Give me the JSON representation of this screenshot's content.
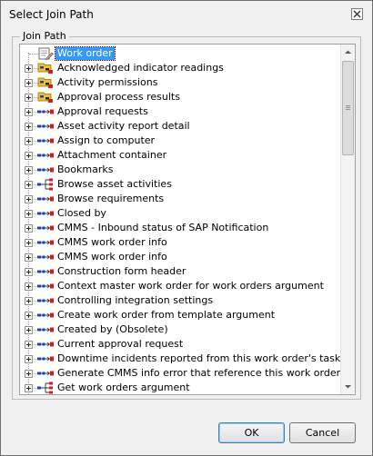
{
  "dialog": {
    "title": "Select Join Path",
    "close_label": "close",
    "group_label": "Join Path",
    "ok_label": "OK",
    "cancel_label": "Cancel"
  },
  "tree": {
    "root": {
      "label": "Work order",
      "icon": "work-order-icon",
      "selected": true
    },
    "items": [
      {
        "label": "Acknowledged indicator readings",
        "icon": "multi-relation-icon"
      },
      {
        "label": "Activity permissions",
        "icon": "multi-relation-icon"
      },
      {
        "label": "Approval process results",
        "icon": "multi-relation-icon"
      },
      {
        "label": "Approval requests",
        "icon": "relation-icon"
      },
      {
        "label": "Asset activity report detail",
        "icon": "relation-icon"
      },
      {
        "label": "Assign to computer",
        "icon": "relation-icon"
      },
      {
        "label": "Attachment container",
        "icon": "relation-icon"
      },
      {
        "label": "Bookmarks",
        "icon": "relation-icon"
      },
      {
        "label": "Browse asset activities",
        "icon": "tree-relation-icon"
      },
      {
        "label": "Browse requirements",
        "icon": "relation-icon"
      },
      {
        "label": "Closed by",
        "icon": "relation-icon"
      },
      {
        "label": "CMMS - Inbound status of SAP Notification",
        "icon": "relation-icon"
      },
      {
        "label": "CMMS work order info",
        "icon": "relation-icon"
      },
      {
        "label": "CMMS work order info",
        "icon": "relation-icon"
      },
      {
        "label": "Construction form header",
        "icon": "relation-icon"
      },
      {
        "label": "Context master work order for work orders argument",
        "icon": "relation-icon"
      },
      {
        "label": "Controlling integration settings",
        "icon": "relation-icon"
      },
      {
        "label": "Create work order from template argument",
        "icon": "relation-icon"
      },
      {
        "label": "Created by (Obsolete)",
        "icon": "relation-icon"
      },
      {
        "label": "Current approval request",
        "icon": "relation-icon"
      },
      {
        "label": "Downtime incidents reported from this work order's tasks",
        "icon": "relation-icon"
      },
      {
        "label": "Generate CMMS info error that reference this work order",
        "icon": "relation-icon"
      },
      {
        "label": "Get work orders argument",
        "icon": "tree-relation-icon"
      }
    ]
  },
  "colors": {
    "selection": "#3399ff",
    "relation_blue": "#1c3fd6",
    "relation_red": "#d61c1c",
    "folder_yellow": "#f0c419"
  }
}
